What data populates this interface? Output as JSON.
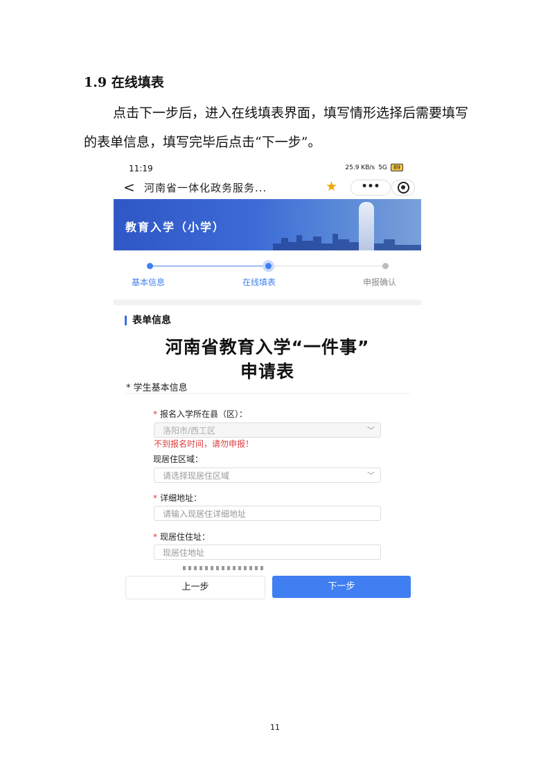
{
  "section": {
    "number": "1.9",
    "title": "在线填表"
  },
  "paragraph": "点击下一步后，进入在线填表界面，填写情形选择后需要填写的表单信息，填写完毕后点击“下一步”。",
  "screenshot": {
    "status_bar": {
      "time": "11:19",
      "net_speed": "25.9 KB/s",
      "signal": "5G",
      "battery": "89"
    },
    "nav": {
      "back_icon": "chevron-left-icon",
      "title": "河南省一体化政务服务...",
      "more_label": "•••"
    },
    "banner": {
      "title": "教育入学（小学）"
    },
    "steps": [
      {
        "label": "基本信息",
        "state": "done"
      },
      {
        "label": "在线填表",
        "state": "current"
      },
      {
        "label": "申报确认",
        "state": "pending"
      }
    ],
    "form": {
      "section_title": "表单信息",
      "heading_line1": "河南省教育入学“一件事”",
      "heading_line2": "申请表",
      "subsection": "* 学生基本信息",
      "fields": [
        {
          "label": "报名入学所在县（区）：",
          "required": true,
          "value": "洛阳市/西工区",
          "type": "select",
          "disabled": true
        },
        {
          "label": "现居住区域：",
          "required": false,
          "placeholder": "请选择现居住区域",
          "type": "select"
        },
        {
          "label": "详细地址：",
          "required": true,
          "placeholder": "请输入现居住详细地址",
          "type": "input"
        },
        {
          "label": "现居住住址：",
          "required": true,
          "placeholder": "现居住地址",
          "type": "input"
        }
      ],
      "error": "不到报名时间，请勿申报！"
    },
    "buttons": {
      "prev": "上一步",
      "next": "下一步"
    },
    "colors": {
      "accent": "#3f7ff1",
      "error": "#e03a3a",
      "star": "#f0a500"
    }
  },
  "page_number": "11"
}
